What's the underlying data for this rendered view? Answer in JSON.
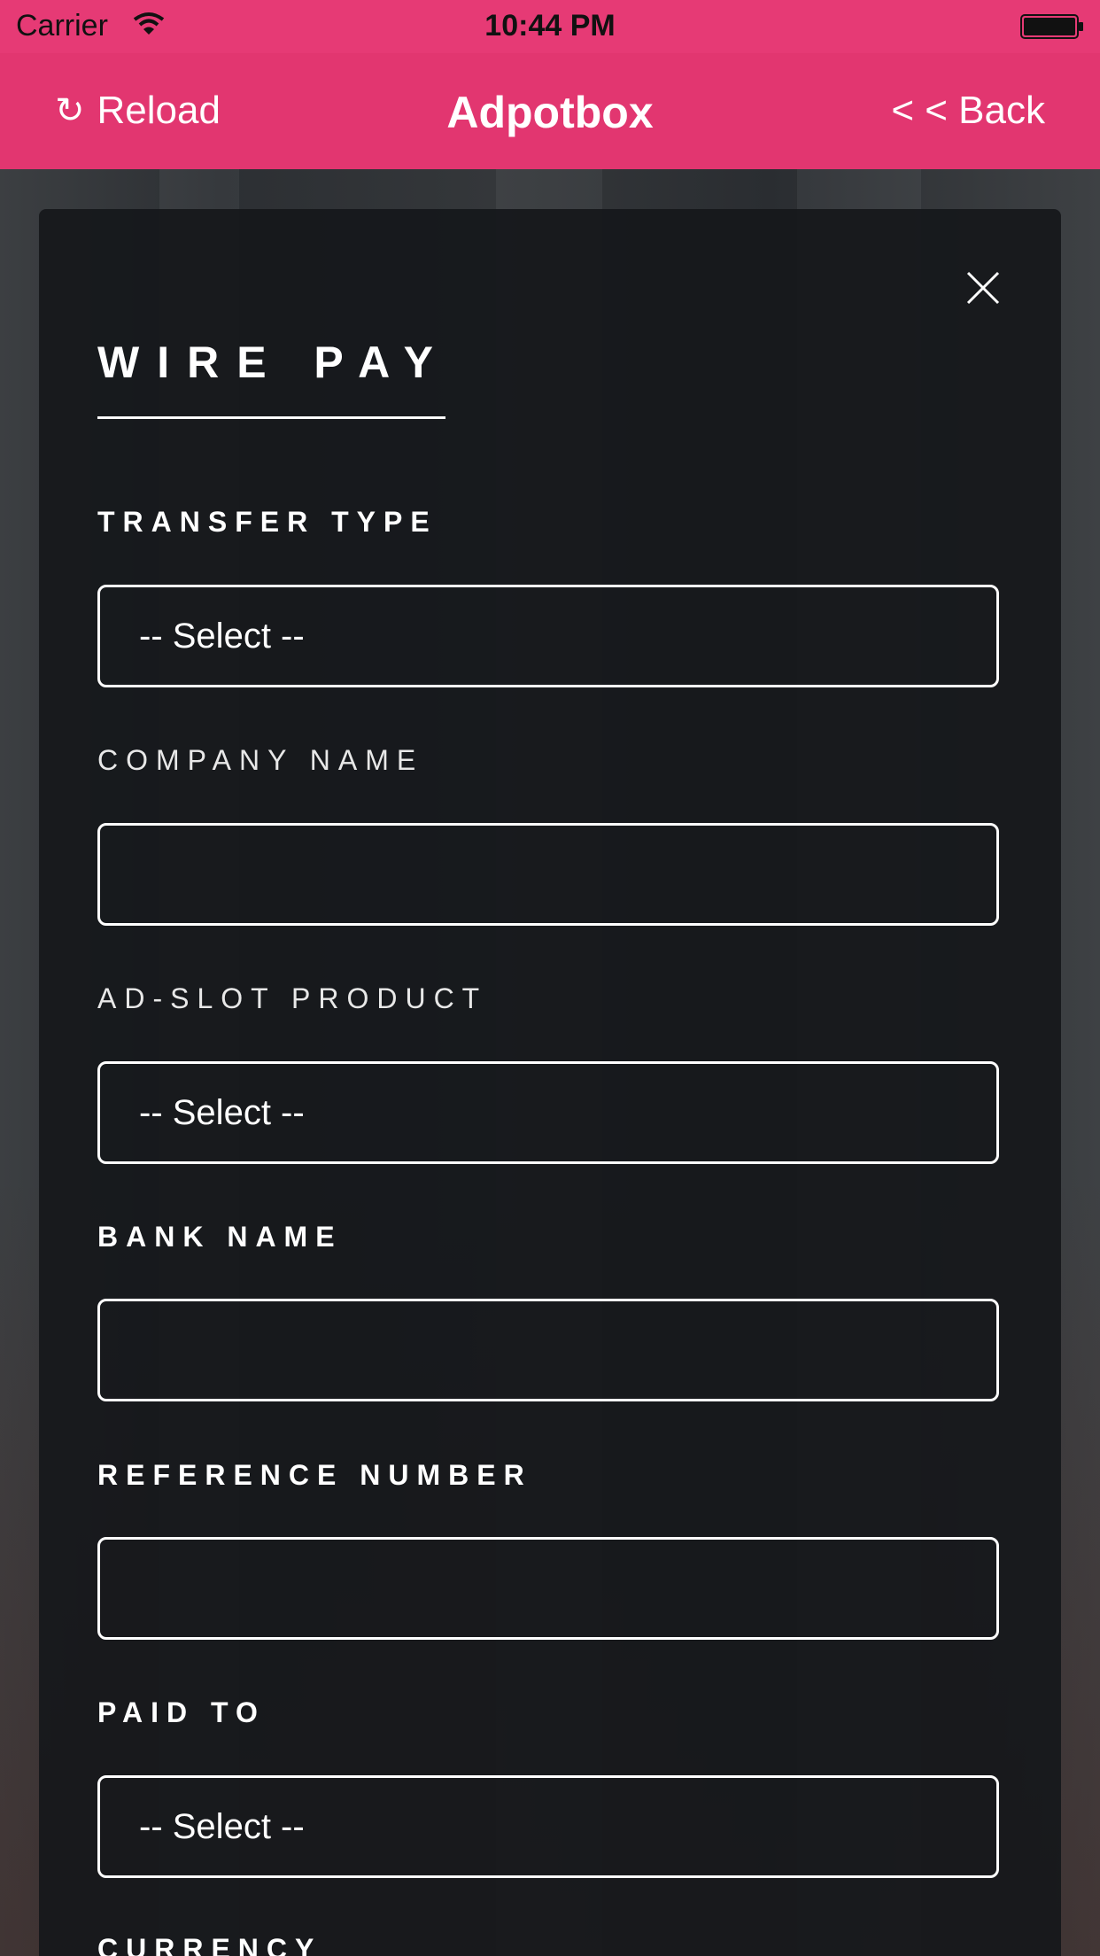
{
  "status_bar": {
    "carrier": "Carrier",
    "time": "10:44 PM",
    "wifi_icon": "wifi-icon",
    "battery_icon": "battery-icon"
  },
  "nav": {
    "reload_icon": "↻",
    "reload_label": "Reload",
    "title": "Adpotbox",
    "back_label": "< < Back",
    "color": "#e23670"
  },
  "form": {
    "title": "WIRE PAY",
    "close_icon": "close-icon",
    "fields": [
      {
        "label": "TRANSFER TYPE",
        "value": "-- Select --",
        "type": "select"
      },
      {
        "label": "COMPANY NAME",
        "value": "",
        "type": "text"
      },
      {
        "label": "AD-SLOT PRODUCT",
        "value": "-- Select --",
        "type": "select"
      },
      {
        "label": "BANK NAME",
        "value": "",
        "type": "text"
      },
      {
        "label": "REFERENCE NUMBER",
        "value": "",
        "type": "text"
      },
      {
        "label": "PAID TO",
        "value": "-- Select --",
        "type": "select"
      },
      {
        "label": "CURRENCY",
        "value": "",
        "type": "select"
      }
    ]
  }
}
